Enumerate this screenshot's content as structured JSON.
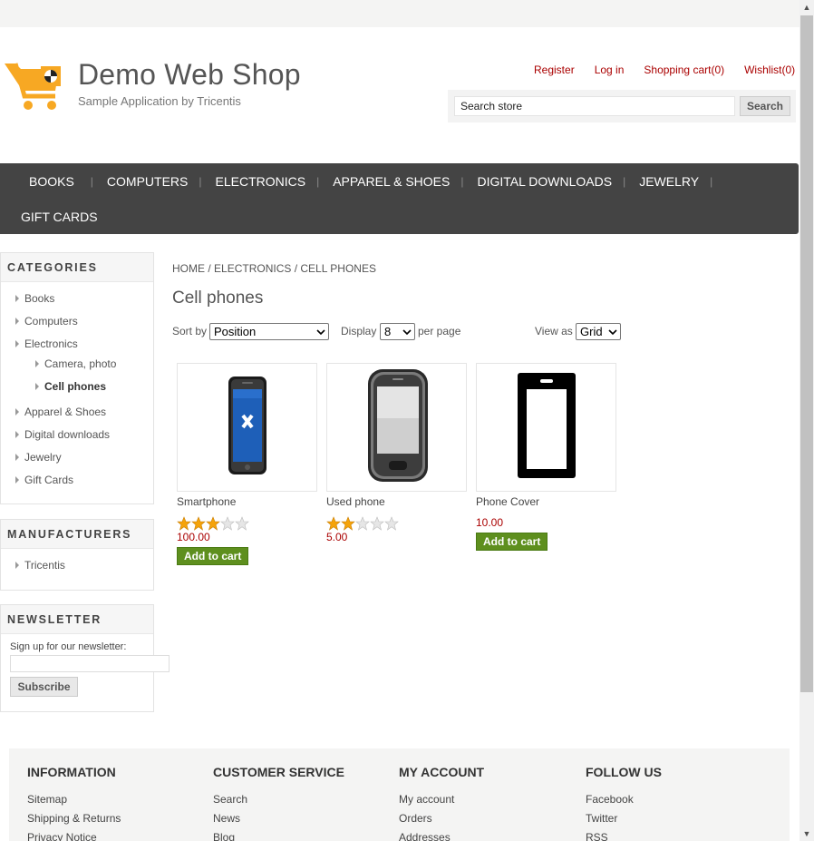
{
  "header": {
    "logo_title": "Demo Web Shop",
    "logo_subtitle": "Sample Application by Tricentis",
    "links": [
      "Register",
      "Log in",
      "Shopping cart(0)",
      "Wishlist(0)"
    ],
    "search_placeholder": "Search store",
    "search_button": "Search"
  },
  "menu": {
    "row1": [
      "Books",
      "Computers",
      "Electronics",
      "Apparel & Shoes",
      "Digital downloads",
      "Jewelry"
    ],
    "row2": [
      "Gift Cards"
    ]
  },
  "sidebar": {
    "categories_title": "Categories",
    "categories": [
      "Books",
      "Computers",
      "Electronics",
      "Camera, photo",
      "Cell phones",
      "Apparel & Shoes",
      "Digital downloads",
      "Jewelry",
      "Gift Cards"
    ],
    "manufacturers_title": "Manufacturers",
    "manufacturers": [
      "Tricentis"
    ],
    "newsletter_title": "Newsletter",
    "newsletter_label": "Sign up for our newsletter:",
    "subscribe_button": "Subscribe"
  },
  "main": {
    "breadcrumb": [
      "Home",
      "Electronics",
      "Cell phones"
    ],
    "title": "Cell phones",
    "sort_label": "Sort by",
    "sort_value": "Position",
    "display_label": "Display",
    "display_value": "8",
    "per_page_label": "per page",
    "view_label": "View as",
    "view_value": "Grid"
  },
  "products": [
    {
      "name": "Smartphone",
      "price": "100.00",
      "rating": 3,
      "button": "Add to cart"
    },
    {
      "name": "Used phone",
      "price": "5.00",
      "rating": 2,
      "button": ""
    },
    {
      "name": "Phone Cover",
      "price": "10.00",
      "rating": null,
      "button": "Add to cart"
    }
  ],
  "footer": {
    "information_title": "Information",
    "information": [
      "Sitemap",
      "Shipping & Returns",
      "Privacy Notice"
    ],
    "customer_service_title": "Customer service",
    "customer_service": [
      "Search",
      "News",
      "Blog"
    ],
    "my_account_title": "My account",
    "my_account": [
      "My account",
      "Orders",
      "Addresses"
    ],
    "follow_us_title": "Follow us",
    "follow_us": [
      "Facebook",
      "Twitter",
      "RSS"
    ]
  },
  "colors": {
    "accent_red": "#aa0000",
    "menu_bg": "#444444",
    "cart_button": "#5e8f1e",
    "star": "#f5a30a"
  }
}
